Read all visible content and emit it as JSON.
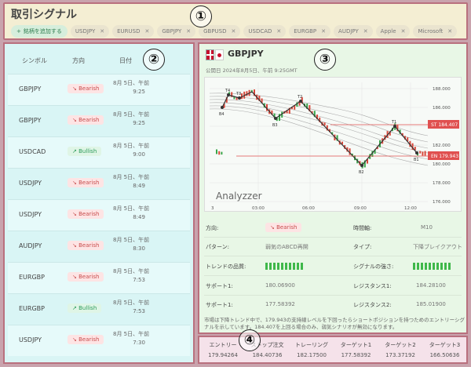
{
  "header": {
    "title": "取引シグナル",
    "add_label": "銘柄を追加する",
    "chips": [
      "USDJPY",
      "EURUSD",
      "GBPJPY",
      "GBPUSD",
      "USDCAD",
      "EURGBP",
      "AUDJPY",
      "Apple",
      "Microsoft"
    ],
    "callout": "①"
  },
  "signals": {
    "callout": "②",
    "columns": {
      "symbol": "シンボル",
      "direction": "方向",
      "date": "日付"
    },
    "rows": [
      {
        "symbol": "GBPJPY",
        "direction": "Bearish",
        "date": "8月 5日、午前",
        "time": "9:25"
      },
      {
        "symbol": "GBPJPY",
        "direction": "Bearish",
        "date": "8月 5日、午前",
        "time": "9:25"
      },
      {
        "symbol": "USDCAD",
        "direction": "Bullish",
        "date": "8月 5日、午前",
        "time": "9:00"
      },
      {
        "symbol": "USDJPY",
        "direction": "Bearish",
        "date": "8月 5日、午前",
        "time": "8:49"
      },
      {
        "symbol": "USDJPY",
        "direction": "Bearish",
        "date": "8月 5日、午前",
        "time": "8:49"
      },
      {
        "symbol": "AUDJPY",
        "direction": "Bearish",
        "date": "8月 5日、午前",
        "time": "8:30"
      },
      {
        "symbol": "EURGBP",
        "direction": "Bearish",
        "date": "8月 5日、午前",
        "time": "7:53"
      },
      {
        "symbol": "EURGBP",
        "direction": "Bullish",
        "date": "8月 5日、午前",
        "time": "7:53"
      },
      {
        "symbol": "USDJPY",
        "direction": "Bearish",
        "date": "8月 5日、午前",
        "time": "7:30"
      }
    ]
  },
  "detail": {
    "callout": "③",
    "pair": "GBPJPY",
    "published": "公開日 2024年8月5日、午前 9:25GMT",
    "chart": {
      "watermark": "Analyzzer",
      "x_ticks": [
        "3",
        "03:00",
        "06:00",
        "09:00",
        "12:00"
      ],
      "y_ticks": [
        "188.000",
        "186.000",
        "184.000",
        "182.000",
        "180.000",
        "178.000",
        "176.000"
      ],
      "sl_label": "ST",
      "sl_value": "184.407",
      "en_label": "EN",
      "en_value": "179.943",
      "points": [
        "B4",
        "T4",
        "T3",
        "B3",
        "T2",
        "B2",
        "T1",
        "B1"
      ]
    },
    "fields": {
      "direction_label": "方向:",
      "direction_value": "Bearish",
      "timeframe_label": "時間軸:",
      "timeframe_value": "M10",
      "pattern_label": "パターン:",
      "pattern_value": "弱気のABCD再開",
      "type_label": "タイプ:",
      "type_value": "下降ブレイクアウト",
      "trend_label": "トレンドの品質:",
      "strength_label": "シグナルの強さ:",
      "support1_label": "サポート1:",
      "support1_value": "180.06900",
      "resist1_label": "レジスタンス1:",
      "resist1_value": "184.28100",
      "support2_label": "サポート1:",
      "support2_value": "177.58392",
      "resist2_label": "レジスタンス2:",
      "resist2_value": "185.01900"
    },
    "trend_quality": 10,
    "signal_strength": 10,
    "description": "市場は下降トレンド中で、179.943の支持線レベルを下回ったらショートポジションを持つためのエントリーシグナルを示しています。184.407を上回る場合のみ、弱気シナリオが無効になります。"
  },
  "trade": {
    "callout": "④",
    "columns": [
      {
        "label": "エントリー",
        "value": "179.94264"
      },
      {
        "label": "ストップ注文",
        "value": "184.40736"
      },
      {
        "label": "トレーリング",
        "value": "182.17500"
      },
      {
        "label": "ターゲット1",
        "value": "177.58392"
      },
      {
        "label": "ターゲット2",
        "value": "173.37192"
      },
      {
        "label": "ターゲット3",
        "value": "166.50636"
      }
    ]
  },
  "colors": {
    "accent": "#b9707e",
    "bearish": "#c84d4d",
    "bullish": "#2c9c5a"
  }
}
